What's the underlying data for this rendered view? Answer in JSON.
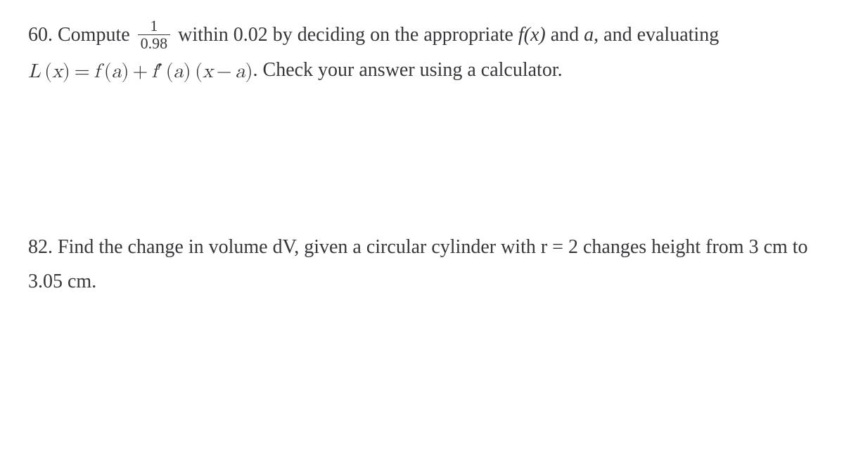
{
  "problem60": {
    "number": "60.",
    "text1": " Compute ",
    "frac_num": "1",
    "frac_den": "0.98",
    "text2": " within 0.02 by deciding on the appropriate ",
    "fx": "f(x)",
    "text3": " and ",
    "a_var": "a",
    "text4": ", and evaluating ",
    "L": "L",
    "paren_open": "(",
    "x": "x",
    "paren_close": ")",
    "eq_sign": "=",
    "f": "f",
    "a": "a",
    "plus": "+",
    "f2": "f",
    "prime": "′",
    "minus": "−",
    "text5": ". Check your answer using a calculator."
  },
  "problem82": {
    "number": "82.",
    "text1": " Find the change in volume dV, given a circular cylinder with r = 2 changes height from 3 cm to 3.05 cm."
  }
}
